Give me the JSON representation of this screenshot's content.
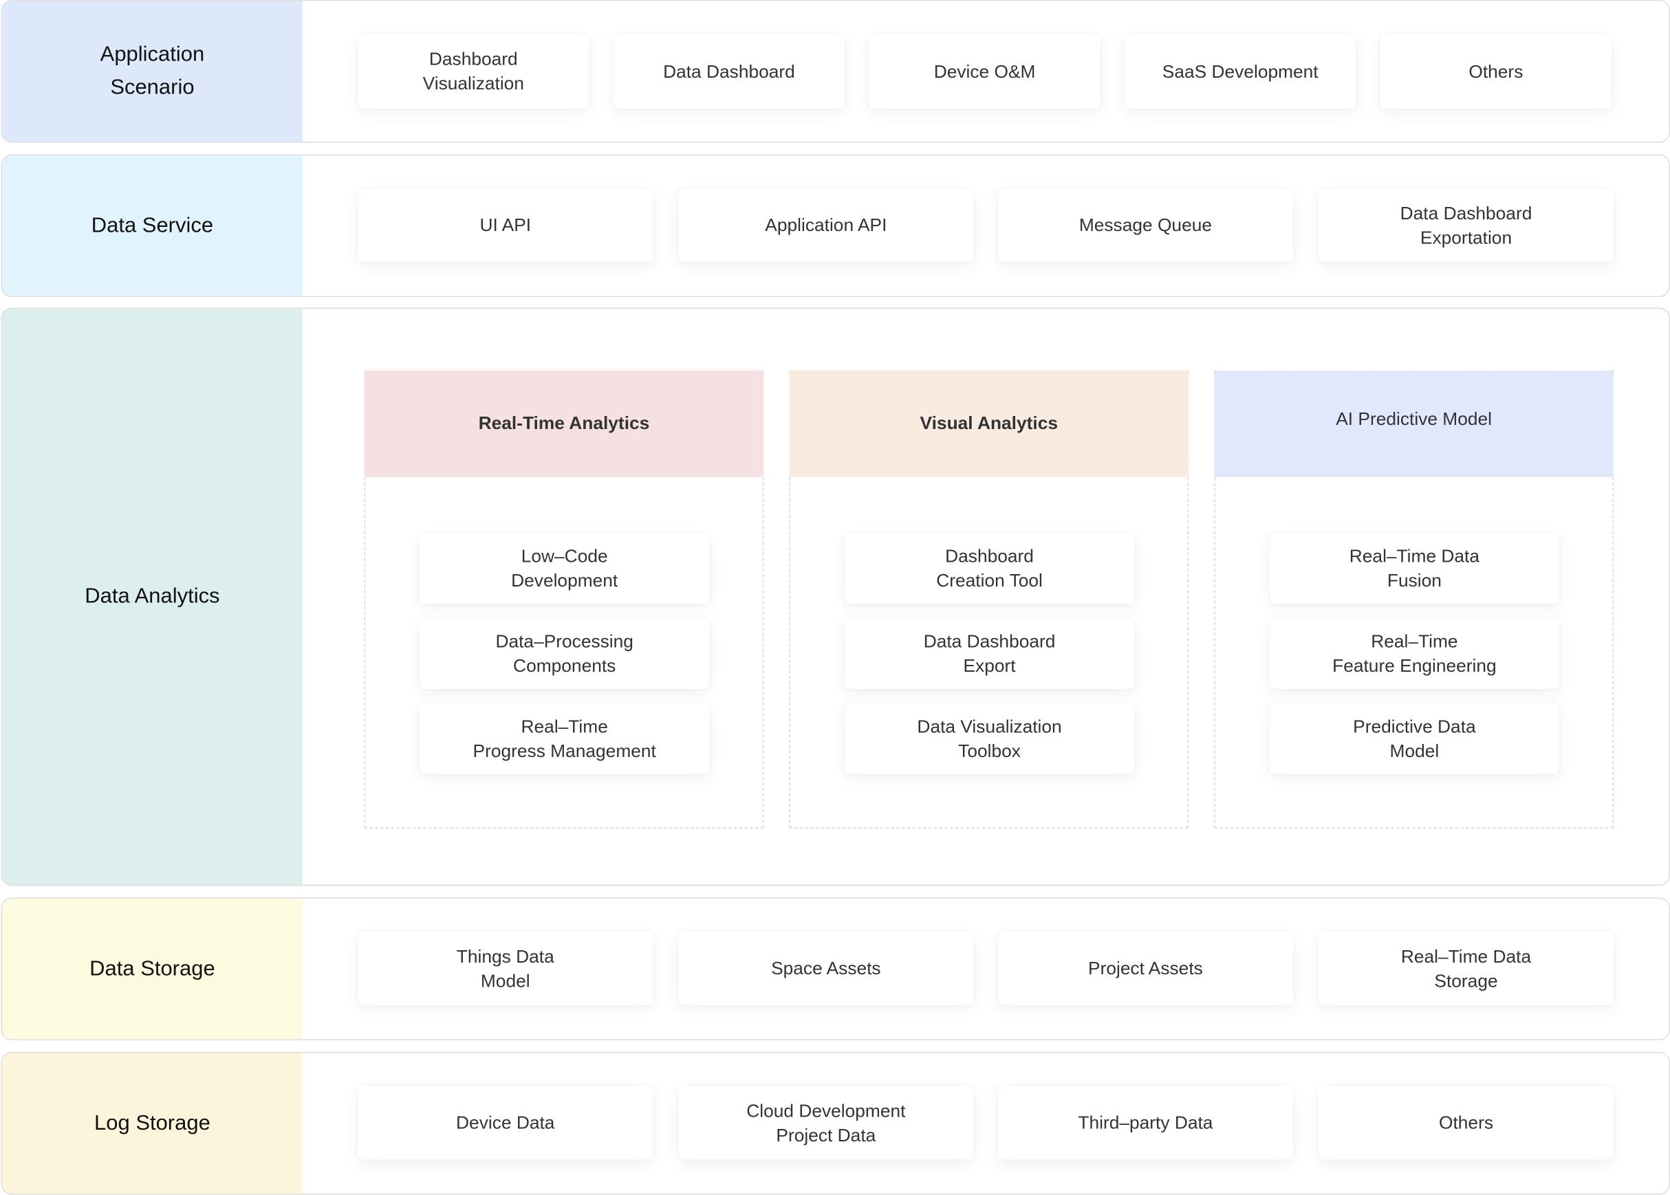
{
  "colors": {
    "application_scenario": "#dde9fb",
    "data_service": "#e1f3fd",
    "data_analytics": "#dcefed",
    "data_storage": "#fcfadf",
    "log_storage": "#fdf4dc",
    "real_time_analytics": "#f5e1e2",
    "visual_analytics": "#f9ebe0",
    "ai_predictive_model": "#e1e8fb"
  },
  "layers": [
    {
      "label": "Application\nScenario",
      "items": [
        "Dashboard\nVisualization",
        "Data Dashboard",
        "Device O&M",
        "SaaS Development",
        "Others"
      ]
    },
    {
      "label": "Data Service",
      "items": [
        "UI API",
        "Application API",
        "Message Queue",
        "Data Dashboard\nExportation"
      ]
    },
    {
      "label": "Data Analytics",
      "columns": [
        {
          "title": "Real-Time Analytics",
          "items": [
            "Low–Code\nDevelopment",
            "Data–Processing\nComponents",
            "Real–Time\nProgress Management"
          ]
        },
        {
          "title": "Visual Analytics",
          "items": [
            "Dashboard\nCreation Tool",
            "Data Dashboard\nExport",
            "Data Visualization\nToolbox"
          ]
        },
        {
          "title": "AI Predictive Model",
          "items": [
            "Real–Time Data\nFusion",
            "Real–Time\nFeature Engineering",
            "Predictive Data\nModel"
          ]
        }
      ]
    },
    {
      "label": "Data Storage",
      "items": [
        "Things Data\nModel",
        "Space Assets",
        "Project Assets",
        "Real–Time Data\nStorage"
      ]
    },
    {
      "label": "Log Storage",
      "items": [
        "Device Data",
        "Cloud Development\nProject Data",
        "Third–party Data",
        "Others"
      ]
    }
  ]
}
